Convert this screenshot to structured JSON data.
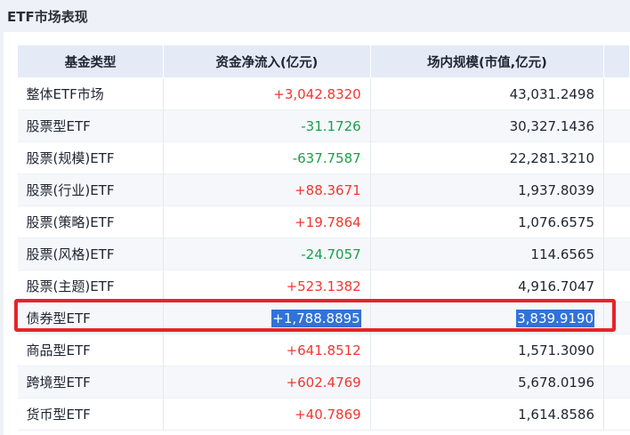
{
  "section_title": "ETF市场表现",
  "headers": {
    "type": "基金类型",
    "flow": "资金净流入(亿元)",
    "size": "场内规模(市值,亿元)"
  },
  "rows": [
    {
      "name": "整体ETF市场",
      "flow": "+3,042.8320",
      "size": "43,031.2498"
    },
    {
      "name": "股票型ETF",
      "flow": "-31.1726",
      "size": "30,327.1436"
    },
    {
      "name": "股票(规模)ETF",
      "flow": "-637.7587",
      "size": "22,281.3210"
    },
    {
      "name": "股票(行业)ETF",
      "flow": "+88.3671",
      "size": "1,937.8039"
    },
    {
      "name": "股票(策略)ETF",
      "flow": "+19.7864",
      "size": "1,076.6575"
    },
    {
      "name": "股票(风格)ETF",
      "flow": "-24.7057",
      "size": "114.6565"
    },
    {
      "name": "股票(主题)ETF",
      "flow": "+523.1382",
      "size": "4,916.7047"
    },
    {
      "name": "债券型ETF",
      "flow": "+1,788.8895",
      "size": "3,839.9190"
    },
    {
      "name": "商品型ETF",
      "flow": "+641.8512",
      "size": "1,571.3090"
    },
    {
      "name": "跨境型ETF",
      "flow": "+602.4769",
      "size": "5,678.0196"
    },
    {
      "name": "货币型ETF",
      "flow": "+40.7869",
      "size": "1,614.8586"
    }
  ],
  "colors": {
    "positive": "#f0372f",
    "negative": "#1d9e4a",
    "selection": "#3172d8",
    "highlight_border": "#e8232a"
  },
  "selected_row": 7
}
